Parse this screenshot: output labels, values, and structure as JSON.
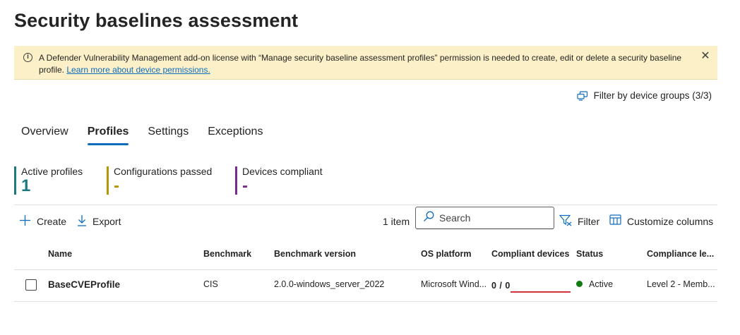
{
  "page": {
    "title": "Security baselines assessment"
  },
  "banner": {
    "icon": "info-icon",
    "message": "A Defender Vulnerability Management add-on license with “Manage security baseline assessment profiles” permission is needed to create, edit or delete a security baseline profile.",
    "link": "Learn more about device permissions.",
    "close_icon": "close-icon"
  },
  "device_filter": {
    "label": "Filter by device groups (3/3)",
    "icon": "device-groups-icon"
  },
  "tabs": [
    {
      "label": "Overview",
      "active": false
    },
    {
      "label": "Profiles",
      "active": true
    },
    {
      "label": "Settings",
      "active": false
    },
    {
      "label": "Exceptions",
      "active": false
    }
  ],
  "metrics": [
    {
      "label": "Active profiles",
      "value": "1",
      "color": "#1b7a80"
    },
    {
      "label": "Configurations passed",
      "value": "-",
      "color": "#b89500"
    },
    {
      "label": "Devices compliant",
      "value": "-",
      "color": "#7a2a8c"
    }
  ],
  "toolbar": {
    "create": "Create",
    "export": "Export",
    "item_count": "1 item",
    "search_placeholder": "Search",
    "filter": "Filter",
    "customize": "Customize columns"
  },
  "table": {
    "columns": [
      "Name",
      "Benchmark",
      "Benchmark version",
      "OS platform",
      "Compliant devices",
      "Status",
      "Compliance le..."
    ],
    "rows": [
      {
        "name": "BaseCVEProfile",
        "benchmark": "CIS",
        "benchmark_version": "2.0.0-windows_server_2022",
        "os_platform": "Microsoft Wind...",
        "compliant_devices": "0 / 0",
        "status": "Active",
        "compliance_level": "Level 2 - Memb..."
      }
    ]
  },
  "colors": {
    "accent": "#0f6cbd",
    "banner_bg": "#fbf0c7",
    "status_active": "#107c10",
    "compliance_bar": "#d13438"
  }
}
